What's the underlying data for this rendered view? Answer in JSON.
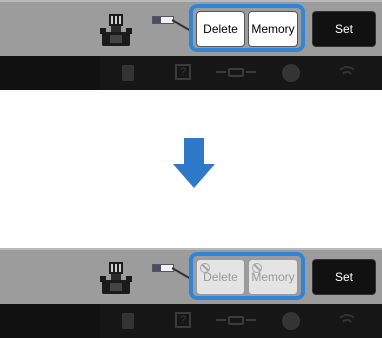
{
  "panels": [
    {
      "state": "before",
      "buttons": {
        "delete": "Delete",
        "memory": "Memory",
        "set": "Set"
      },
      "delete_disabled": false,
      "memory_disabled": false
    },
    {
      "state": "after",
      "buttons": {
        "delete": "Delete",
        "memory": "Memory",
        "set": "Set"
      },
      "delete_disabled": true,
      "memory_disabled": true
    }
  ],
  "icons": {
    "embroidery_unit": "embroidery-frame-icon",
    "thread": "thread-spool-icon",
    "arrow": "down-arrow-icon",
    "status_bar": [
      "document-icon",
      "help-icon",
      "frame-move-icon",
      "thread-color-icon",
      "wifi-icon"
    ],
    "disabled_marker": "prohibited-icon"
  },
  "colors": {
    "highlight": "#2f86d9",
    "arrow": "#2e79c8",
    "toolbar_bg": "#9c9c9c",
    "status_bg": "#111111",
    "set_button_bg": "#111111"
  }
}
